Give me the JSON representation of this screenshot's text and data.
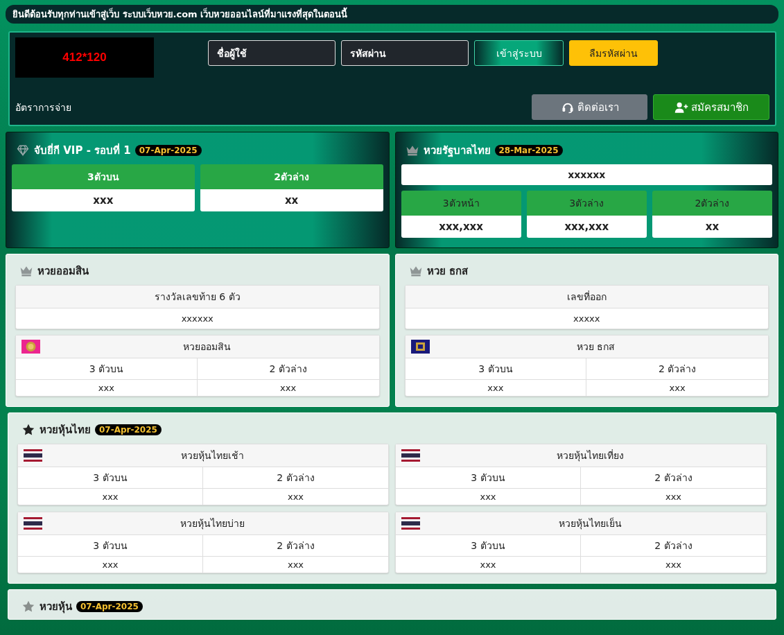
{
  "marquee": "ยินดีต้อนรับทุกท่านเข้าสู่เว็บ ระบบเว็บหวย.com เว็บหวยออนไลน์ที่มาแรงที่สุดในตอนนี้",
  "login": {
    "logo_text": "412*120",
    "username_placeholder": "ชื่อผู้ใช้",
    "password_placeholder": "รหัสผ่าน",
    "buttons": [
      {
        "label": "เข้าสู่ระบบ",
        "kind": "login"
      },
      {
        "label": "ลืมรหัสผ่าน",
        "kind": "forgot"
      }
    ],
    "payout_link": "อัตราการจ่าย",
    "actions": [
      {
        "label": "ติดต่อเรา",
        "kind": "contact"
      },
      {
        "label": "สมัครสมาชิก",
        "kind": "register"
      }
    ]
  },
  "featured": [
    {
      "kind": "vip",
      "title": "จับยี่กี VIP - รอบที่ 1",
      "date": "07-Apr-2025",
      "columns": [
        {
          "label": "3ตัวบน",
          "value": "xxx"
        },
        {
          "label": "2ตัวล่าง",
          "value": "xx"
        }
      ]
    },
    {
      "kind": "government",
      "title": "หวยรัฐบาลไทย",
      "date": "28-Mar-2025",
      "first_prize": "xxxxxx",
      "columns": [
        {
          "label": "3ตัวหน้า",
          "value": "xxx,xxx"
        },
        {
          "label": "3ตัวล่าง",
          "value": "xxx,xxx"
        },
        {
          "label": "2ตัวล่าง",
          "value": "xx"
        }
      ]
    }
  ],
  "banks": [
    {
      "kind": "gsb",
      "title": "หวยออมสิน",
      "prize_label": "รางวัลเลขท้าย 6 ตัว",
      "prize_value": "xxxxxx",
      "result_name": "หวยออมสิน",
      "columns": [
        {
          "label": "3 ตัวบน",
          "value": "xxx"
        },
        {
          "label": "2 ตัวล่าง",
          "value": "xxx"
        }
      ]
    },
    {
      "kind": "baac",
      "title": "หวย ธกส",
      "prize_label": "เลขที่ออก",
      "prize_value": "xxxxx",
      "result_name": "หวย ธกส",
      "columns": [
        {
          "label": "3 ตัวบน",
          "value": "xxx"
        },
        {
          "label": "2 ตัวล่าง",
          "value": "xxx"
        }
      ]
    }
  ],
  "stocks": {
    "title": "หวยหุ้นไทย",
    "date": "07-Apr-2025",
    "markets": [
      {
        "name": "หวยหุ้นไทยเช้า",
        "columns": [
          {
            "label": "3 ตัวบน",
            "value": "xxx"
          },
          {
            "label": "2 ตัวล่าง",
            "value": "xxx"
          }
        ]
      },
      {
        "name": "หวยหุ้นไทยเที่ยง",
        "columns": [
          {
            "label": "3 ตัวบน",
            "value": "xxx"
          },
          {
            "label": "2 ตัวล่าง",
            "value": "xxx"
          }
        ]
      },
      {
        "name": "หวยหุ้นไทยบ่าย",
        "columns": [
          {
            "label": "3 ตัวบน",
            "value": "xxx"
          },
          {
            "label": "2 ตัวล่าง",
            "value": "xxx"
          }
        ]
      },
      {
        "name": "หวยหุ้นไทยเย็น",
        "columns": [
          {
            "label": "3 ตัวบน",
            "value": "xxx"
          },
          {
            "label": "2 ตัวล่าง",
            "value": "xxx"
          }
        ]
      }
    ]
  },
  "next_section": {
    "title": "หวยหุ้น",
    "date": "07-Apr-2025"
  }
}
